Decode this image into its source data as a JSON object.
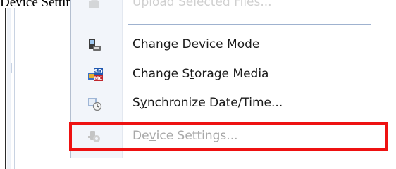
{
  "caption": {
    "text": "Device Settings\" in [Device] menu will be grayed"
  },
  "menu": {
    "items": [
      {
        "label": "Upload Selected Files...",
        "icon": "upload-icon",
        "state": "partially-visible"
      },
      {
        "label": "Change Device Mode",
        "mnemonic": "M",
        "icon": "device-mode-icon",
        "state": "enabled"
      },
      {
        "label": "Change Storage Media",
        "mnemonic": "t",
        "icon": "storage-media-icon",
        "state": "enabled"
      },
      {
        "label": "Synchronize Date/Time...",
        "mnemonic": "y",
        "icon": "clock-sync-icon",
        "state": "enabled"
      },
      {
        "label": "Device Settings...",
        "mnemonic": "v",
        "icon": "device-settings-icon",
        "state": "disabled"
      }
    ],
    "storage_icon_text": {
      "top": "SD",
      "bottom": "MC"
    }
  },
  "colors": {
    "highlight_box": "#ee1111",
    "disabled_text": "#a8a8a8",
    "separator": "#9fb2cf"
  }
}
